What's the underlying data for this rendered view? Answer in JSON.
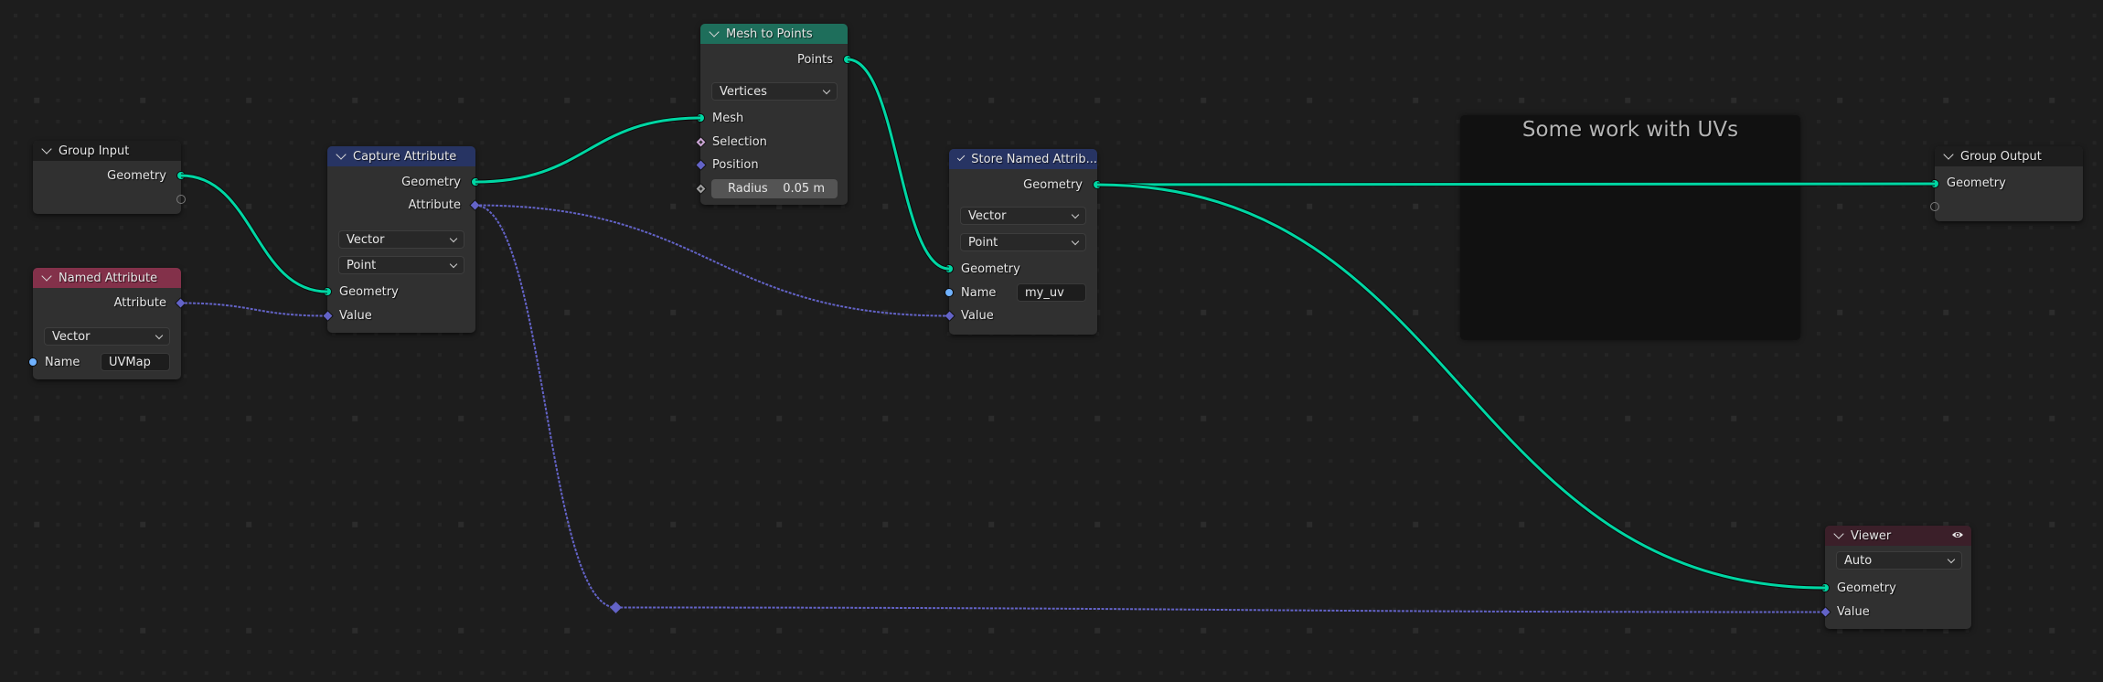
{
  "editor": "Geometry Node Editor",
  "colors": {
    "background": "#1d1d1d",
    "node_body": "#303030",
    "header_input": "#1d1d1d",
    "header_attribute": "#273463",
    "header_geometry": "#1e6e5b",
    "header_named_attr": "#83314a",
    "header_output": "#3b1f29",
    "socket_geometry": "#00d6a3",
    "socket_vector": "#6363c7",
    "socket_string": "#70b2ff",
    "socket_boolean": "#cca6d6",
    "socket_float": "#a1a1a1",
    "frame_bg": "#111111"
  },
  "frame": {
    "label": "Some work with UVs"
  },
  "nodes": {
    "group_input": {
      "title": "Group Input",
      "outputs": [
        "Geometry"
      ]
    },
    "named_attribute": {
      "title": "Named Attribute",
      "outputs": [
        "Attribute"
      ],
      "data_type": "Vector",
      "inputs": [
        {
          "label": "Name",
          "value": "UVMap"
        }
      ]
    },
    "capture_attribute": {
      "title": "Capture Attribute",
      "outputs": [
        "Geometry",
        "Attribute"
      ],
      "data_type": "Vector",
      "domain": "Point",
      "inputs": [
        "Geometry",
        "Value"
      ]
    },
    "mesh_to_points": {
      "title": "Mesh to Points",
      "outputs": [
        "Points"
      ],
      "mode": "Vertices",
      "inputs": [
        "Mesh",
        "Selection",
        "Position"
      ],
      "radius": {
        "label": "Radius",
        "value": "0.05 m"
      }
    },
    "store_named_attribute": {
      "title": "Store Named Attrib...",
      "outputs": [
        "Geometry"
      ],
      "data_type": "Vector",
      "domain": "Point",
      "inputs": [
        "Geometry",
        "Name",
        "Value"
      ],
      "name_value": "my_uv"
    },
    "group_output": {
      "title": "Group Output",
      "inputs": [
        "Geometry"
      ]
    },
    "viewer": {
      "title": "Viewer",
      "domain": "Auto",
      "inputs": [
        "Geometry",
        "Value"
      ]
    }
  },
  "links": [
    {
      "from": "group_input.Geometry",
      "to": "capture_attribute.Geometry",
      "type": "geometry"
    },
    {
      "from": "named_attribute.Attribute",
      "to": "capture_attribute.Value",
      "type": "vector"
    },
    {
      "from": "capture_attribute.Geometry",
      "to": "mesh_to_points.Mesh",
      "type": "geometry"
    },
    {
      "from": "capture_attribute.Attribute",
      "to": "store_named_attribute.Value",
      "type": "vector"
    },
    {
      "from": "capture_attribute.Attribute",
      "to": "reroute",
      "type": "vector"
    },
    {
      "from": "reroute",
      "to": "viewer.Value",
      "type": "vector"
    },
    {
      "from": "mesh_to_points.Points",
      "to": "store_named_attribute.Geometry",
      "type": "geometry"
    },
    {
      "from": "store_named_attribute.Geometry",
      "to": "group_output.Geometry",
      "type": "geometry"
    },
    {
      "from": "store_named_attribute.Geometry",
      "to": "viewer.Geometry",
      "type": "geometry"
    }
  ]
}
